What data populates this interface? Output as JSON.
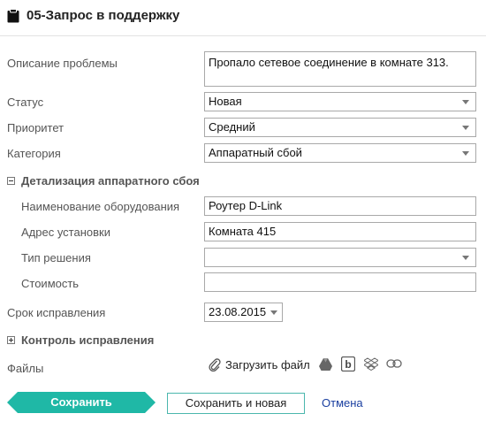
{
  "header": {
    "title": "05-Запрос в поддержку"
  },
  "form": {
    "description": {
      "label": "Описание проблемы",
      "value": "Пропало сетевое соединение в комнате 313."
    },
    "status": {
      "label": "Статус",
      "value": "Новая"
    },
    "priority": {
      "label": "Приоритет",
      "value": "Средний"
    },
    "category": {
      "label": "Категория",
      "value": "Аппаратный сбой"
    },
    "hardware_section": {
      "title": "Детализация аппаратного сбоя",
      "equipment": {
        "label": "Наименование оборудования",
        "value": "Роутер D-Link"
      },
      "address": {
        "label": "Адрес установки",
        "value": "Комната 415"
      },
      "solution_type": {
        "label": "Тип решения",
        "value": ""
      },
      "cost": {
        "label": "Стоимость",
        "value": ""
      }
    },
    "due_date": {
      "label": "Срок исправления",
      "value": "23.08.2015"
    },
    "control_section": {
      "title": "Контроль исправления"
    },
    "files": {
      "label": "Файлы",
      "upload_label": "Загрузить файл"
    }
  },
  "buttons": {
    "save": "Сохранить",
    "save_new": "Сохранить и новая",
    "cancel": "Отмена"
  },
  "colors": {
    "accent": "#1fb8a6",
    "link": "#1a3fa0"
  }
}
